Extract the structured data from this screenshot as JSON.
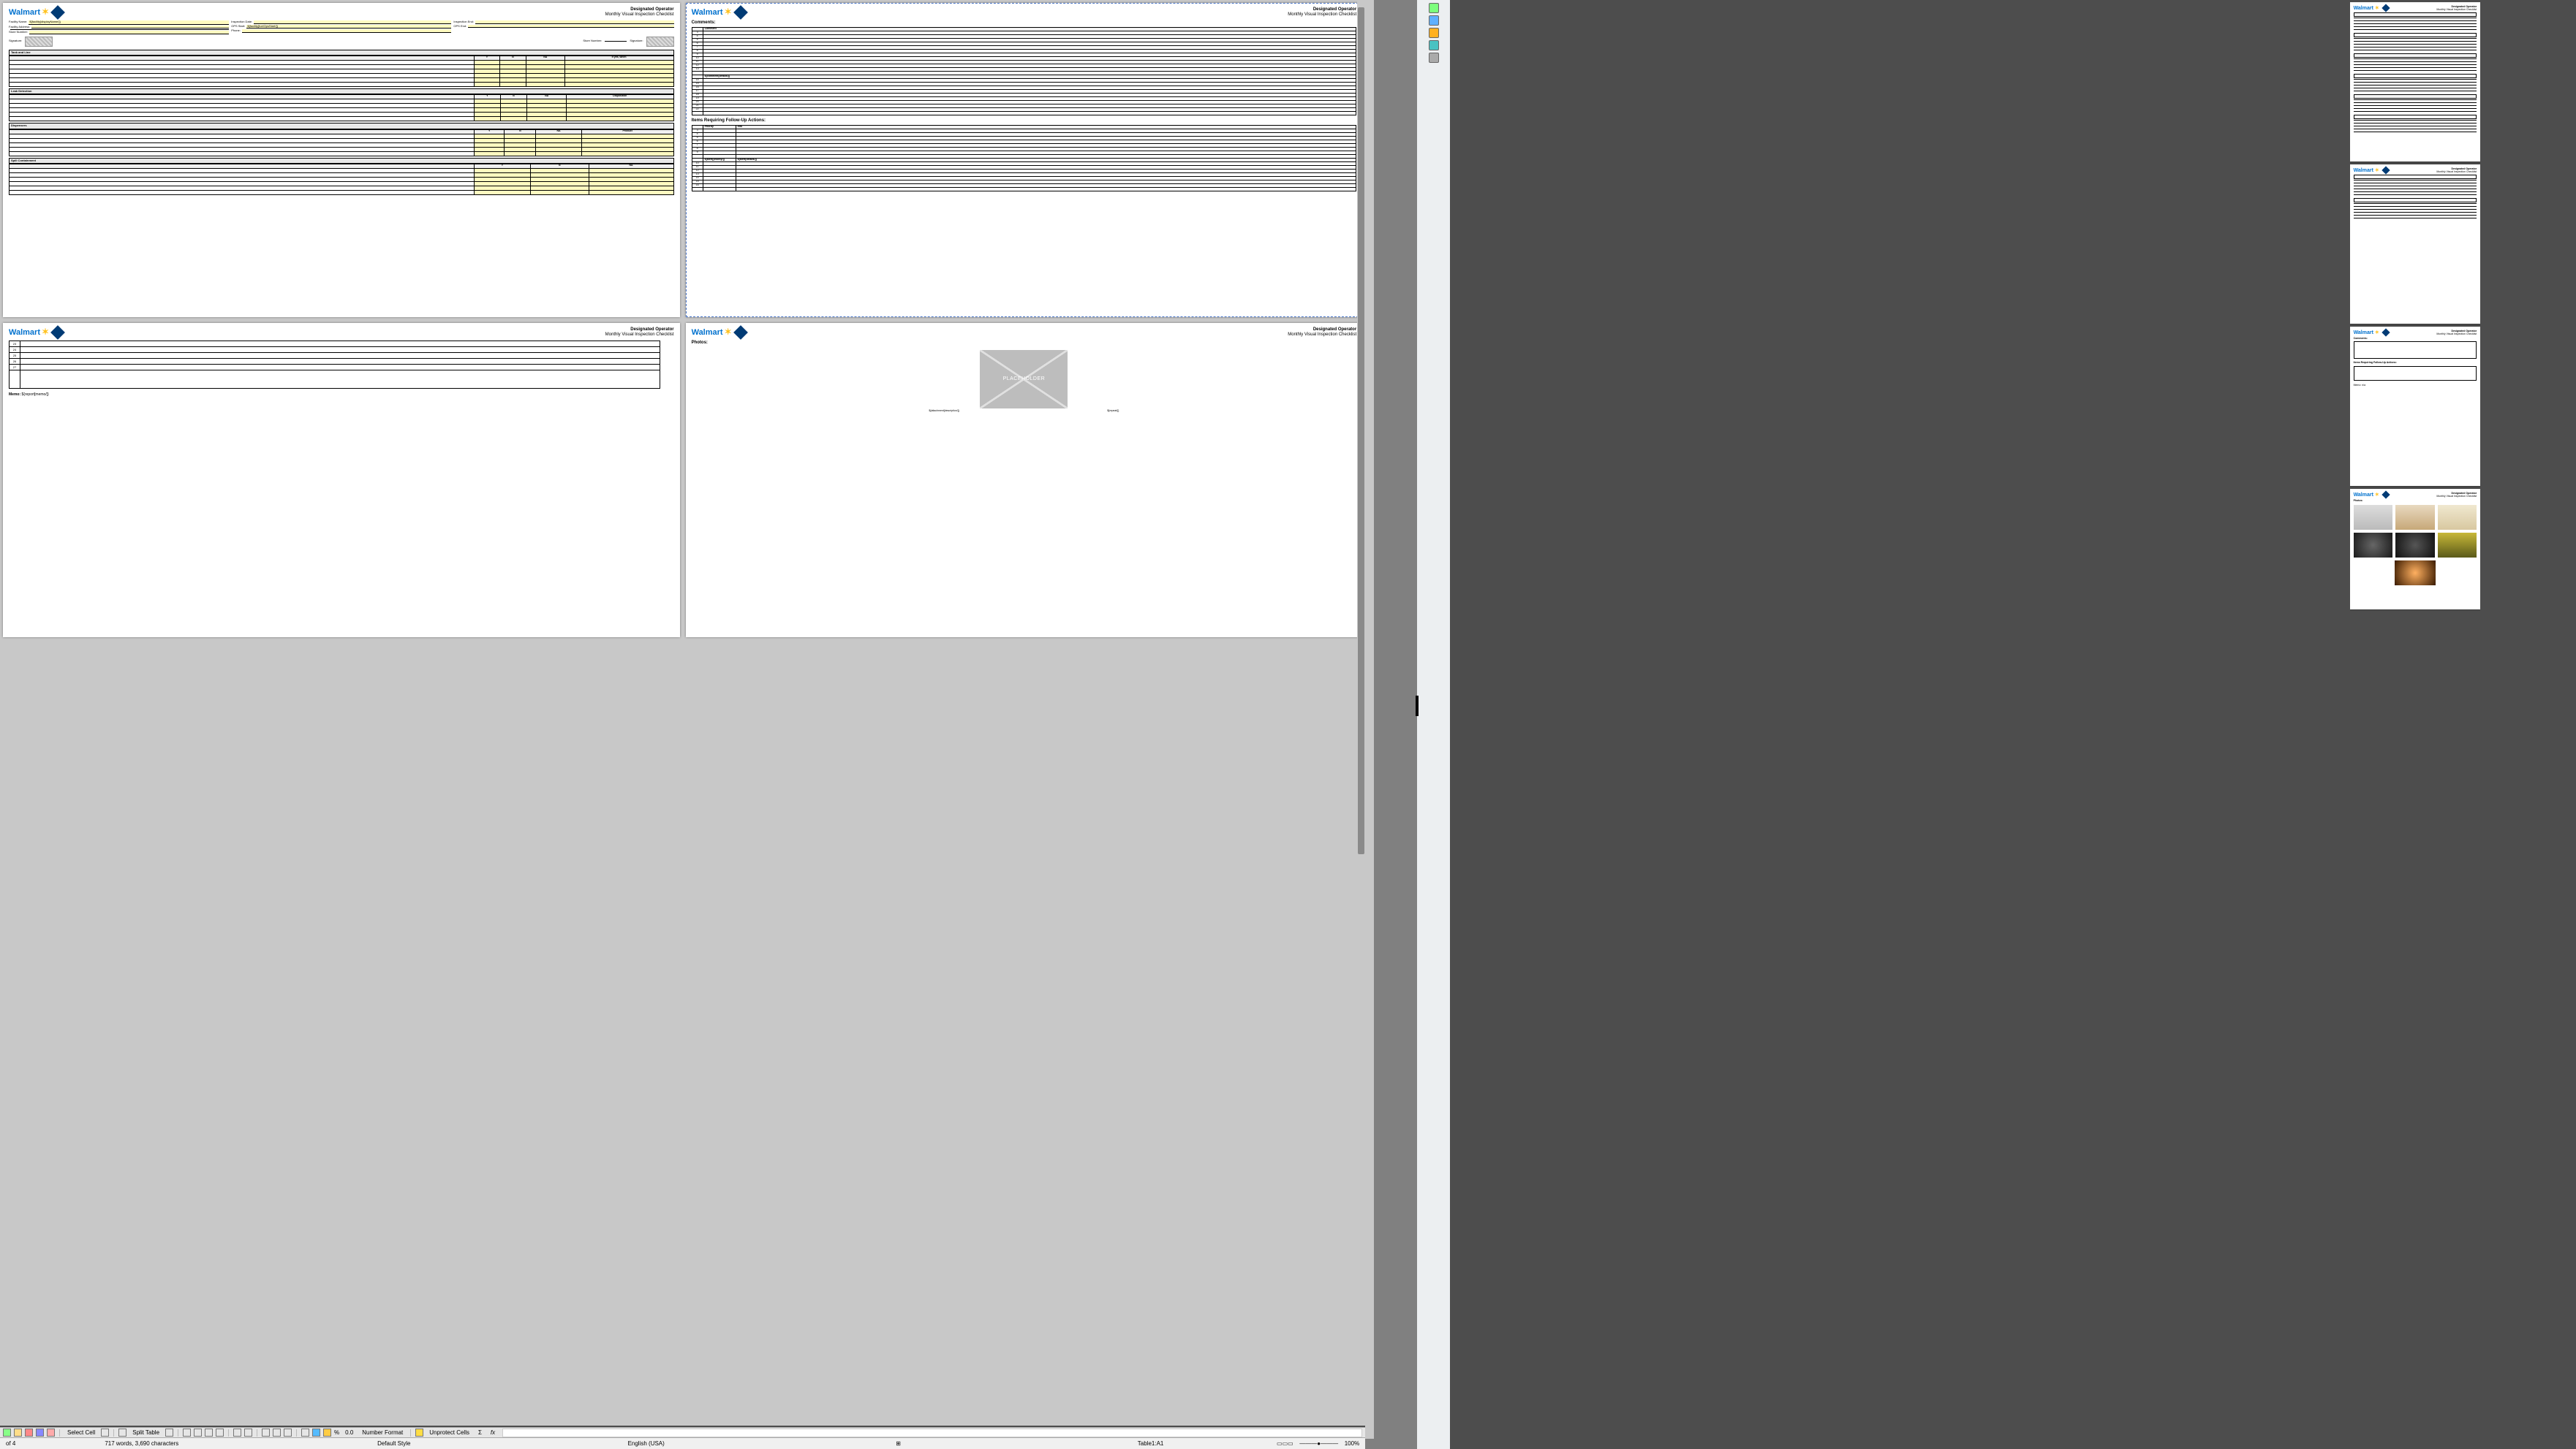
{
  "header": {
    "logo": "Walmart",
    "line1": "Designated Operator",
    "line2": "Monthly Visual Inspection Checklist"
  },
  "placeholder_label": "PLACEHOLDER",
  "page1": {
    "meta_left": [
      {
        "lab": "Facility Name:",
        "val": "${facility[displayName/]}"
      },
      {
        "lab": "Facility Address:",
        "val": ""
      },
      {
        "lab": "",
        "val": ""
      },
      {
        "lab": "Store Number:",
        "val": ""
      }
    ],
    "meta_right_a": [
      {
        "lab": "Inspection Date:",
        "val": ""
      },
      {
        "lab": "OPS Start:",
        "val": "${facility[fuelOpsStart/]}"
      },
      {
        "lab": "Phone:",
        "val": ""
      }
    ],
    "meta_right_b": [
      {
        "lab": "Inspection End:",
        "val": ""
      },
      {
        "lab": "OPS End:",
        "val": ""
      }
    ],
    "sig": {
      "signature_lab": "Signature:",
      "store_lab": "Store Number:",
      "signature2_lab": "Signature:"
    },
    "sections": [
      {
        "title": "Tank and Line",
        "cols": [
          "Y",
          "N",
          "NA",
          "If yes, when"
        ],
        "rows": 6
      },
      {
        "title": "Leak Detection",
        "cols": [
          "Y",
          "N",
          "NA",
          "Disposition"
        ],
        "rows": 5,
        "wide": true
      },
      {
        "title": "Dispensers",
        "cols": [
          "Y",
          "N",
          "NA",
          "Product"
        ],
        "rows": 5,
        "wide": true
      },
      {
        "title": "Spill Containment",
        "cols": [
          "Y",
          "N",
          "NA"
        ],
        "rows": 6
      }
    ]
  },
  "page2": {
    "comments_lbl": "Comments:",
    "comment_hdr": "Comment",
    "comment_foot": "${comment[details/]}",
    "followup_lbl": "Items Requiring Follow-Up Actions:",
    "followup_cols": [
      "Priority",
      "Info"
    ],
    "followup_foot": [
      "${alert[priority/]}",
      "${alert[details/]}"
    ],
    "row_nums": [
      "3",
      "4",
      "5",
      "6",
      "7",
      "8",
      "9",
      "10",
      "11",
      "12",
      "13",
      "14",
      "15",
      "16",
      "17",
      "18",
      "19",
      "20",
      "21",
      "22"
    ]
  },
  "page3": {
    "row_nums": [
      "23",
      "24",
      "25",
      "26",
      "27"
    ],
    "memo_lbl": "Memo:",
    "memo_val": "${report[memo/]}"
  },
  "page4": {
    "photos_lbl": "Photos:",
    "cap_left": "${attachment[description/]}",
    "cap_right": "${repeat/]}"
  },
  "thumbs": {
    "t2_rows": [
      "",
      "",
      "",
      "",
      "",
      "",
      "",
      "",
      ""
    ],
    "t3_comments": "Comments:",
    "t3_follow": "Items Requiring Follow-Up Actions:",
    "t3_memo": "Memo: n/a",
    "t4_photos": "Photos:"
  },
  "statusbar": {
    "select_cell": "Select Cell",
    "split_table": "Split Table",
    "number_fmt": "Number Format",
    "pct": "0.0",
    "unprotect": "Unprotect Cells",
    "sigma": "Σ",
    "fx": "fx"
  },
  "statusbar2": {
    "pages": "of 4",
    "words": "717 words, 3,690 characters",
    "style": "Default Style",
    "lang": "English (USA)",
    "sel": "⊞",
    "table": "Table1:A1",
    "zoom": "100%"
  }
}
